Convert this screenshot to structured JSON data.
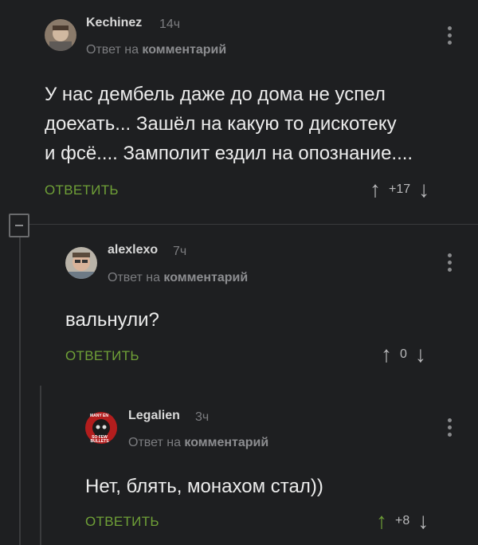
{
  "reply_prefix": "Ответ на",
  "reply_target": "комментарий",
  "comments": [
    {
      "author": "Kechinez",
      "time": "14ч",
      "text_lines": [
        "У нас дембель даже до дома не успел",
        "доехать... Зашёл на какую то дискотеку",
        "и фсё.... Замполит ездил на опознание...."
      ],
      "reply_label": "ОТВЕТИТЬ",
      "score": "+17"
    },
    {
      "author": "alexlexo",
      "time": "7ч",
      "text_lines": [
        "вальнули?"
      ],
      "reply_label": "ОТВЕТИТЬ",
      "score": "0"
    },
    {
      "author": "Legalien",
      "time": "3ч",
      "text_lines": [
        "Нет, блять, монахом стал))"
      ],
      "reply_label": "ОТВЕТИТЬ",
      "score": "+8",
      "avatar_text_top": "MANY EN",
      "avatar_text_bottom": "SO FEW BULLETS"
    }
  ],
  "icons": {
    "upvote": "up-arrow-icon",
    "downvote": "down-arrow-icon",
    "more": "more-vertical-icon",
    "collapse": "collapse-minus-icon"
  },
  "colors": {
    "background": "#1e1f21",
    "accent_green": "#6fa037",
    "muted": "#7c7d80"
  }
}
